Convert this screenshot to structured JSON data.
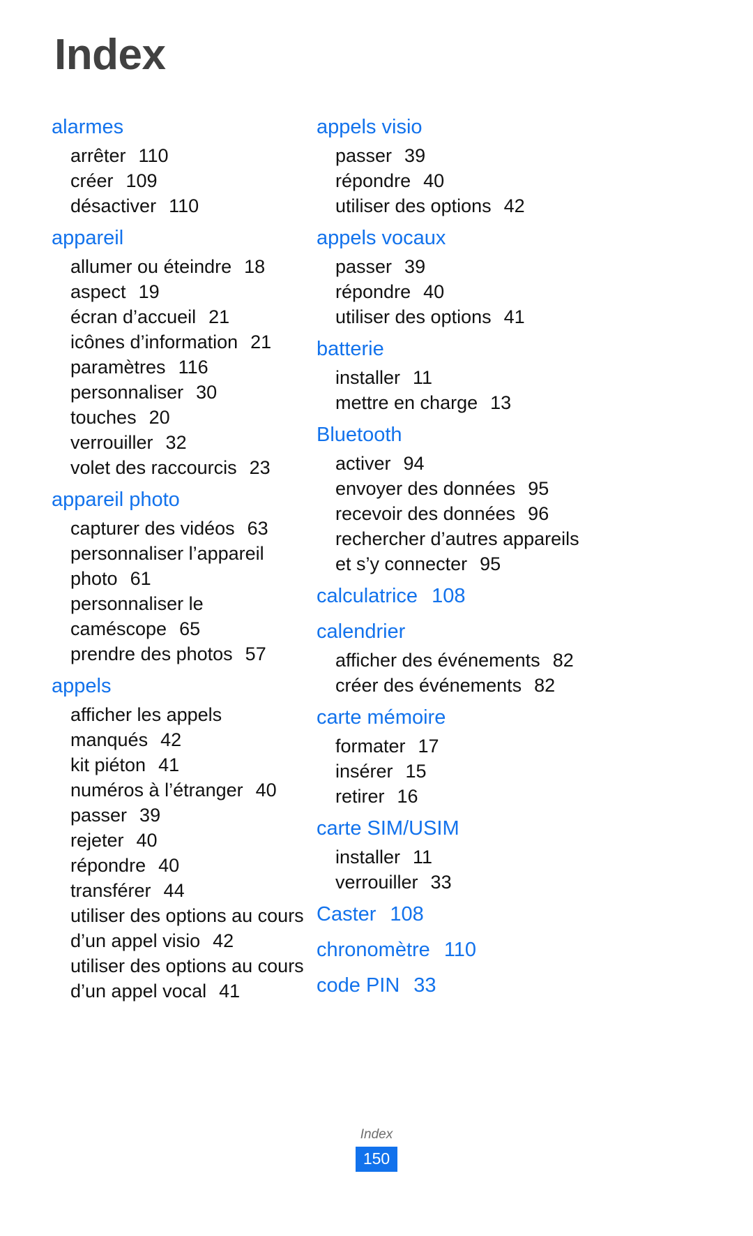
{
  "document": {
    "title": "Index",
    "accent_color": "#1272ec",
    "title_color": "#414141",
    "body_color": "#111111"
  },
  "footer": {
    "label": "Index",
    "page_number": "150"
  },
  "columns": {
    "left": [
      {
        "head": "alarmes",
        "head_page": "",
        "subs": [
          {
            "label": "arrêter",
            "page": "110"
          },
          {
            "label": "créer",
            "page": "109"
          },
          {
            "label": "désactiver",
            "page": "110"
          }
        ]
      },
      {
        "head": "appareil",
        "head_page": "",
        "subs": [
          {
            "label": "allumer ou éteindre",
            "page": "18"
          },
          {
            "label": "aspect",
            "page": "19"
          },
          {
            "label": "écran d’accueil",
            "page": "21"
          },
          {
            "label": "icônes d’information",
            "page": "21"
          },
          {
            "label": "paramètres",
            "page": "116"
          },
          {
            "label": "personnaliser",
            "page": "30"
          },
          {
            "label": "touches",
            "page": "20"
          },
          {
            "label": "verrouiller",
            "page": "32"
          },
          {
            "label": "volet des raccourcis",
            "page": "23"
          }
        ]
      },
      {
        "head": "appareil photo",
        "head_page": "",
        "subs": [
          {
            "label": "capturer des vidéos",
            "page": "63"
          },
          {
            "label": "personnaliser l’appareil",
            "page": ""
          },
          {
            "label": "photo",
            "page": "61"
          },
          {
            "label": "personnaliser le",
            "page": ""
          },
          {
            "label": "caméscope",
            "page": "65"
          },
          {
            "label": "prendre des photos",
            "page": "57"
          }
        ]
      },
      {
        "head": "appels",
        "head_page": "",
        "subs": [
          {
            "label": "afficher les appels",
            "page": ""
          },
          {
            "label": "manqués",
            "page": "42"
          },
          {
            "label": "kit piéton",
            "page": "41"
          },
          {
            "label": "numéros à l’étranger",
            "page": "40"
          },
          {
            "label": "passer",
            "page": "39"
          },
          {
            "label": "rejeter",
            "page": "40"
          },
          {
            "label": "répondre",
            "page": "40"
          },
          {
            "label": "transférer",
            "page": "44"
          },
          {
            "label": "utiliser des options au cours",
            "page": ""
          },
          {
            "label": "d’un appel visio",
            "page": "42"
          },
          {
            "label": "utiliser des options au cours",
            "page": ""
          },
          {
            "label": "d’un appel vocal",
            "page": "41"
          }
        ]
      }
    ],
    "right": [
      {
        "head": "appels visio",
        "head_page": "",
        "subs": [
          {
            "label": "passer",
            "page": "39"
          },
          {
            "label": "répondre",
            "page": "40"
          },
          {
            "label": "utiliser des options",
            "page": "42"
          }
        ]
      },
      {
        "head": "appels vocaux",
        "head_page": "",
        "subs": [
          {
            "label": "passer",
            "page": "39"
          },
          {
            "label": "répondre",
            "page": "40"
          },
          {
            "label": "utiliser des options",
            "page": "41"
          }
        ]
      },
      {
        "head": "batterie",
        "head_page": "",
        "subs": [
          {
            "label": "installer",
            "page": "11"
          },
          {
            "label": "mettre en charge",
            "page": "13"
          }
        ]
      },
      {
        "head": "Bluetooth",
        "head_page": "",
        "subs": [
          {
            "label": "activer",
            "page": "94"
          },
          {
            "label": "envoyer des données",
            "page": "95"
          },
          {
            "label": "recevoir des données",
            "page": "96"
          },
          {
            "label": "rechercher d’autres appareils",
            "page": ""
          },
          {
            "label": "et s’y connecter",
            "page": "95"
          }
        ]
      },
      {
        "head": "calculatrice",
        "head_page": "108",
        "subs": []
      },
      {
        "head": "calendrier",
        "head_page": "",
        "subs": [
          {
            "label": "afficher des événements",
            "page": "82"
          },
          {
            "label": "créer des événements",
            "page": "82"
          }
        ]
      },
      {
        "head": "carte mémoire",
        "head_page": "",
        "subs": [
          {
            "label": "formater",
            "page": "17"
          },
          {
            "label": "insérer",
            "page": "15"
          },
          {
            "label": "retirer",
            "page": "16"
          }
        ]
      },
      {
        "head": "carte SIM/USIM",
        "head_page": "",
        "subs": [
          {
            "label": "installer",
            "page": "11"
          },
          {
            "label": "verrouiller",
            "page": "33"
          }
        ]
      },
      {
        "head": "Caster",
        "head_page": "108",
        "subs": []
      },
      {
        "head": "chronomètre",
        "head_page": "110",
        "subs": []
      },
      {
        "head": "code PIN",
        "head_page": "33",
        "subs": []
      }
    ]
  }
}
